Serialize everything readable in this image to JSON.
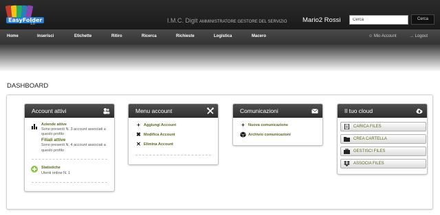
{
  "header": {
    "logo_name": "EasyFolder",
    "logo_version": "1.0",
    "org": "I.M.C. Digit",
    "role": "AMMINISTRATORE GESTORE DEL SERVIZIO",
    "user": "Mario2 Rossi",
    "search_value": "Cerca",
    "search_button": "Cerca"
  },
  "nav": {
    "items": [
      "Home",
      "Inserisci",
      "Etichette",
      "Ritiro",
      "Ricerca",
      "Richieste",
      "Logistica",
      "Macero"
    ],
    "account": "Mio Account",
    "logout": "Logout"
  },
  "page": {
    "title": "DASHBOARD"
  },
  "cards": {
    "account": {
      "title": "Account attivi",
      "icon": "users-icon",
      "aziende_label": "Aziende attive",
      "aziende_line1": "Sono presenti N. 3 account associati a",
      "aziende_line2": "questo profilo",
      "filiali_label": "Filiali attive",
      "filiali_line1": "Sono presenti N. 4 account associati a",
      "filiali_line2": "questo profilo",
      "stats_label": "Statistiche",
      "stats_line": "Utenti online N. 1"
    },
    "menu": {
      "title": "Menu account",
      "icon": "tools-icon",
      "items": [
        "Aggiungi Account",
        "Modifica Account",
        "Elimina Account"
      ]
    },
    "comm": {
      "title": "Comunicazioni",
      "icon": "envelope-icon",
      "items": [
        "Nuova comunicazione",
        "Archivio comunicazioni"
      ]
    },
    "cloud": {
      "title": "Il tuo cloud",
      "icon": "cloud-upload-icon",
      "buttons": [
        "CARICA FILES",
        "CREA CARTELLA",
        "GESTISCI FILES",
        "ASSOCIA FILES"
      ]
    }
  },
  "colors": {
    "link": "#556b1e",
    "header_dark": "#2c2c2c",
    "accent_green": "#8bc34a"
  }
}
